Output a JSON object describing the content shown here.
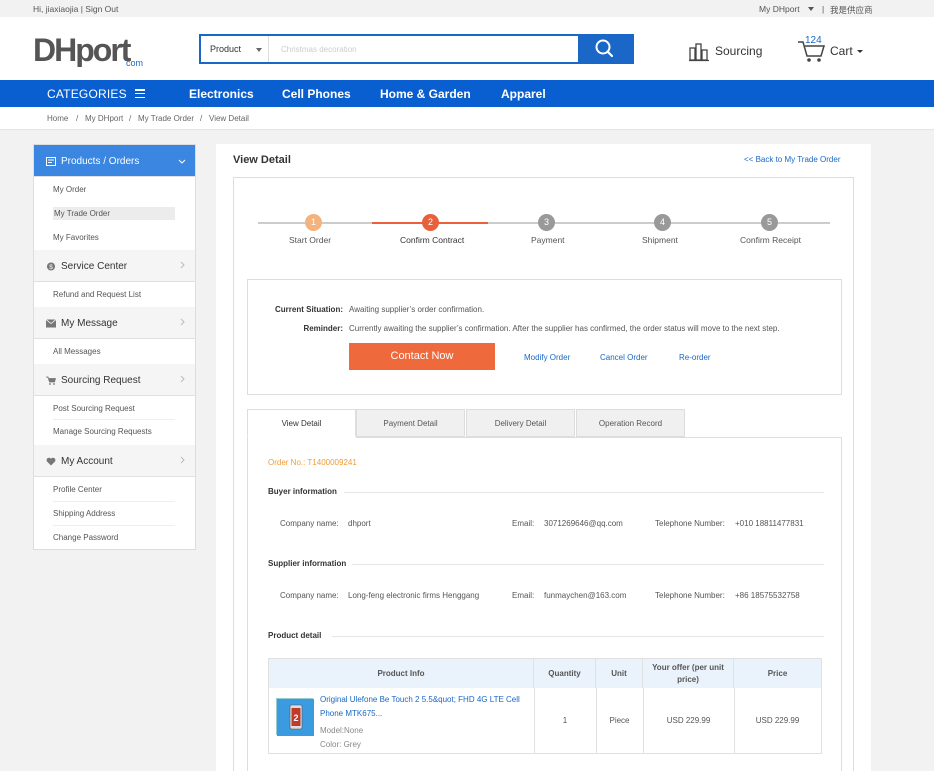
{
  "topbar": {
    "greeting": "Hi, jiaxiaojia | Sign Out",
    "my_dhport": "My DHport",
    "separator": "|",
    "supplier": "我是供应商"
  },
  "header": {
    "logo": {
      "brand": "DHport",
      "sub": "com"
    },
    "search": {
      "category": "Product",
      "placeholder": "Christmas decoration"
    },
    "sourcing": "Sourcing",
    "cart": {
      "count": "124",
      "label": "Cart"
    }
  },
  "nav": {
    "categories": "CATEGORIES",
    "items": [
      "Electronics",
      "Cell Phones",
      "Home & Garden",
      "Apparel"
    ]
  },
  "breadcrumb": [
    "Home",
    "/",
    "My DHport",
    "/",
    "My Trade Order",
    "/",
    "View Detail"
  ],
  "sidebar": {
    "sections": [
      {
        "label": "Products / Orders",
        "icon": "orders-icon",
        "items": [
          "My Order",
          "My Trade Order",
          "My Favorites"
        ]
      },
      {
        "label": "Service Center",
        "icon": "service-icon",
        "items": [
          "Refund and Request List"
        ]
      },
      {
        "label": "My Message",
        "icon": "mail-icon",
        "items": [
          "All Messages"
        ]
      },
      {
        "label": "Sourcing Request",
        "icon": "cart-icon",
        "items": [
          "Post Sourcing Request",
          "Manage Sourcing Requests"
        ]
      },
      {
        "label": "My Account",
        "icon": "heart-icon",
        "items": [
          "Profile Center",
          "Shipping Address",
          "Change Password"
        ]
      }
    ]
  },
  "main": {
    "title": "View Detail",
    "back_link": "<< Back to My Trade Order",
    "steps": [
      {
        "num": "1",
        "label": "Start Order"
      },
      {
        "num": "2",
        "label": "Confirm Contract"
      },
      {
        "num": "3",
        "label": "Payment"
      },
      {
        "num": "4",
        "label": "Shipment"
      },
      {
        "num": "5",
        "label": "Confirm Receipt"
      }
    ],
    "situation": {
      "current_key": "Current Situation:",
      "current_val": "Awaiting supplier’s order confirmation.",
      "reminder_key": "Reminder:",
      "reminder_val": "Currently awaiting the supplier’s confirmation. After the supplier has confirmed, the order status will move to the next step.",
      "contact_button": "Contact Now",
      "links": [
        "Modify Order",
        "Cancel Order",
        "Re-order"
      ]
    },
    "tabs": [
      "View Detail",
      "Payment Detail",
      "Delivery Detail",
      "Operation Record"
    ],
    "order_no": "Order No.: T1400009241",
    "buyer": {
      "heading": "Buyer information",
      "company_key": "Company name:",
      "company": "dhport",
      "email_key": "Email:",
      "email": "3071269646@qq.com",
      "tel_key": "Telephone Number:",
      "tel": "+010 18811477831"
    },
    "supplier": {
      "heading": "Supplier information",
      "company_key": "Company name:",
      "company": "Long-feng electronic firms Henggang",
      "email_key": "Email:",
      "email": "funmaychen@163.com",
      "tel_key": "Telephone Number:",
      "tel": "+86 18575532758"
    },
    "product": {
      "heading": "Product detail",
      "columns": [
        "Product Info",
        "Quantity",
        "Unit",
        "Your offer (per unit price)",
        "Price"
      ],
      "row": {
        "name": "Original Ulefone Be Touch 2 5.5&quot; FHD 4G LTE Cell Phone MTK675...",
        "model": "Model:None",
        "color": "Color: Grey",
        "quantity": "1",
        "unit": "Piece",
        "offer": "USD 229.99",
        "price": "USD 229.99"
      }
    }
  }
}
